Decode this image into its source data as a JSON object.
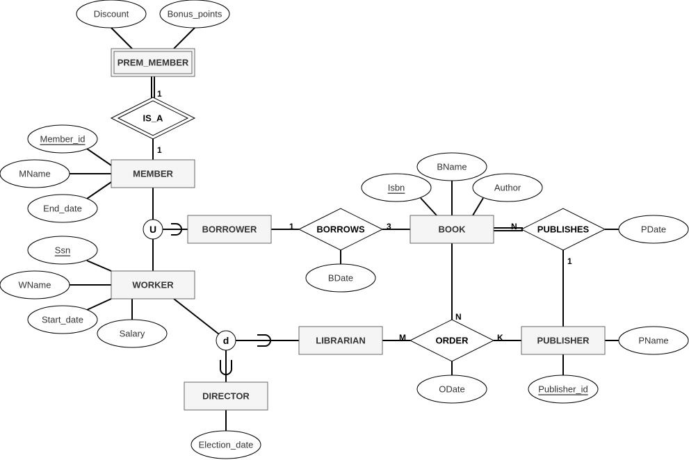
{
  "entities": [
    {
      "id": "prem_member",
      "label": "PREM_MEMBER",
      "weak": true
    },
    {
      "id": "member",
      "label": "MEMBER",
      "weak": false
    },
    {
      "id": "borrower",
      "label": "BORROWER",
      "weak": false
    },
    {
      "id": "worker",
      "label": "WORKER",
      "weak": false
    },
    {
      "id": "book",
      "label": "BOOK",
      "weak": false
    },
    {
      "id": "librarian",
      "label": "LIBRARIAN",
      "weak": false
    },
    {
      "id": "publisher",
      "label": "PUBLISHER",
      "weak": false
    },
    {
      "id": "director",
      "label": "DIRECTOR",
      "weak": false
    }
  ],
  "relationships": [
    {
      "id": "is_a",
      "label": "IS_A",
      "identifying": true
    },
    {
      "id": "borrows",
      "label": "BORROWS",
      "identifying": false
    },
    {
      "id": "publishes",
      "label": "PUBLISHES",
      "identifying": false
    },
    {
      "id": "order",
      "label": "ORDER",
      "identifying": false
    }
  ],
  "attributes": [
    {
      "id": "discount",
      "label": "Discount",
      "key": false
    },
    {
      "id": "bonus_points",
      "label": "Bonus_points",
      "key": false
    },
    {
      "id": "member_id",
      "label": "Member_id",
      "key": true
    },
    {
      "id": "mname",
      "label": "MName",
      "key": false
    },
    {
      "id": "end_date",
      "label": "End_date",
      "key": false
    },
    {
      "id": "ssn",
      "label": "Ssn",
      "key": true
    },
    {
      "id": "wname",
      "label": "WName",
      "key": false
    },
    {
      "id": "start_date",
      "label": "Start_date",
      "key": false
    },
    {
      "id": "salary",
      "label": "Salary",
      "key": false
    },
    {
      "id": "isbn",
      "label": "Isbn",
      "key": true
    },
    {
      "id": "bname",
      "label": "BName",
      "key": false
    },
    {
      "id": "author",
      "label": "Author",
      "key": false
    },
    {
      "id": "bdate",
      "label": "BDate",
      "key": false
    },
    {
      "id": "pdate",
      "label": "PDate",
      "key": false
    },
    {
      "id": "odate",
      "label": "ODate",
      "key": false
    },
    {
      "id": "pname",
      "label": "PName",
      "key": false
    },
    {
      "id": "publisher_id",
      "label": "Publisher_id",
      "key": true
    },
    {
      "id": "election_date",
      "label": "Election_date",
      "key": false
    }
  ],
  "special_nodes": [
    {
      "id": "union",
      "label": "U"
    },
    {
      "id": "disjoint",
      "label": "d"
    }
  ],
  "cardinalities": [
    {
      "id": "prem_isa",
      "label": "1"
    },
    {
      "id": "isa_member",
      "label": "1"
    },
    {
      "id": "borrower_borrows",
      "label": "1"
    },
    {
      "id": "borrows_book",
      "label": "3"
    },
    {
      "id": "book_publishes",
      "label": "N"
    },
    {
      "id": "publishes_publisher",
      "label": "1"
    },
    {
      "id": "book_order",
      "label": "N"
    },
    {
      "id": "librarian_order",
      "label": "M"
    },
    {
      "id": "order_publisher",
      "label": "K"
    }
  ]
}
